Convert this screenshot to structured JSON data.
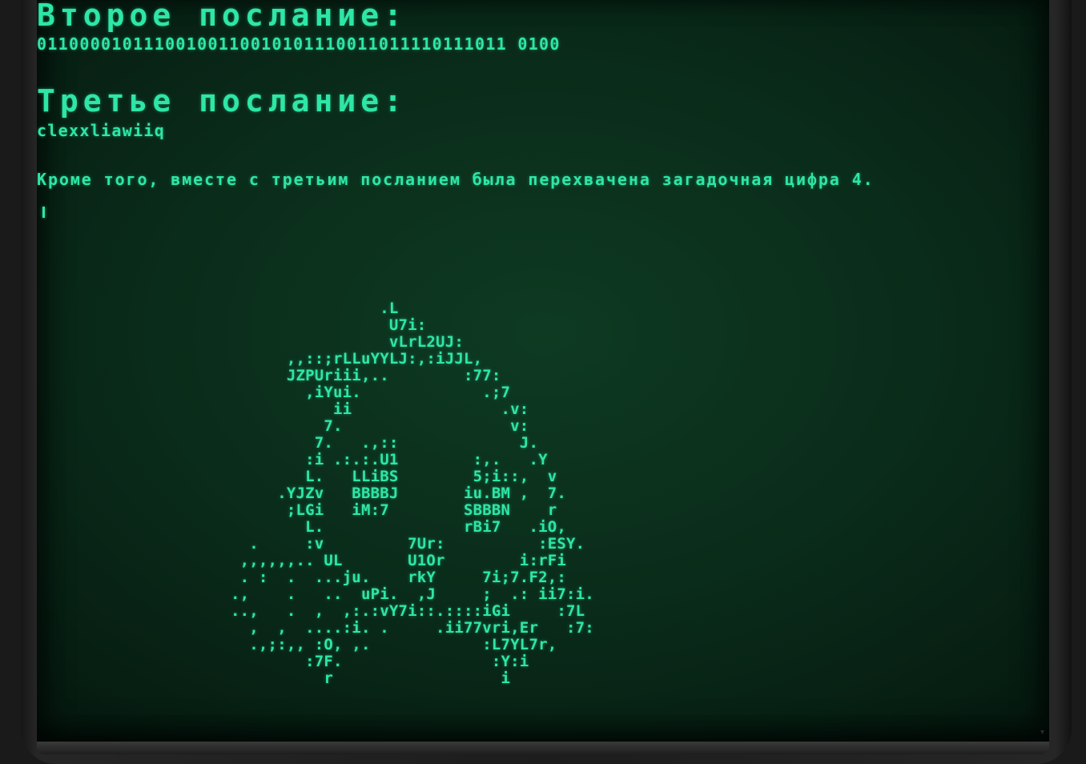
{
  "terminal": {
    "second_message": {
      "heading": "Второе послание:",
      "content": "01100001011100100110010101110011011110111011 0100"
    },
    "third_message": {
      "heading": "Третье послание:",
      "content": "clexxliawiiq"
    },
    "note": "Кроме того, вместе с третьим посланием была перехвачена загадочная цифра 4.",
    "ascii_art": "                .L\n                 U7i:\n                 vLrL2UJ:\n      ,,::;rLLuYYLJ:,:iJJL,\n      JZPUriii,..        :77:\n        ,iYui.             .;7\n           ii                .v:\n          7.                  v:\n         7.   .,::             J.\n        :i .:.:.U1        :,.   .Y\n        L.   LLiBS        5;i::,  v\n     .YJZv   BBBBJ       iu.BM ,  7.\n      ;LGi   iM:7        SBBBN    r\n        L.               rBi7   .iO,\n  .     :v         7Ur:          :ESY.\n ,,,,,,.. UL       U1Or        i:rFi\n . :  .  ...ju.    rkY     7i;7.F2,:\n.,    .   ..  uPi.  ,J     ;  .: ii7:i.\n..,   .  ,  ,:.:vY7i::.::::iGi     :7L\n  ,  ,  ....:i. .     .ii77vri,Er   :7:\n  .,;:,, :O, ,.            :L7YL7r,\n        :7F.                :Y:i\n          r                  i"
  }
}
